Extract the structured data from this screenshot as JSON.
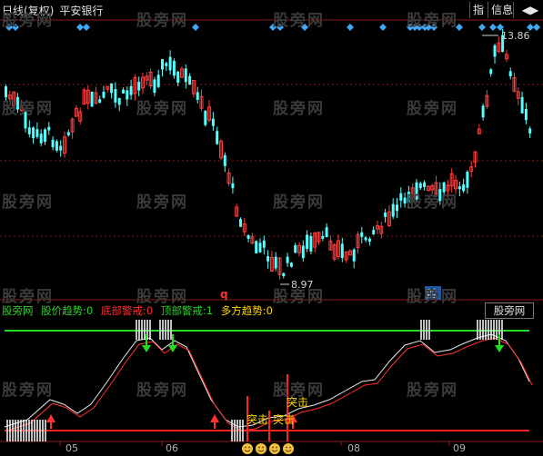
{
  "header": {
    "period": "日线(复权)",
    "stock_name": "平安银行",
    "btn_index": "指",
    "btn_info": "信息",
    "btn_nav": "◀▶"
  },
  "watermark": "股旁网",
  "main_chart": {
    "high_label": "13.86",
    "low_label": "8.97",
    "marker_q": "q",
    "marker_cai": "财"
  },
  "indicator": {
    "name": "股旁网",
    "legend": [
      {
        "label": "股价趋势:",
        "value": "0",
        "color": "#2fd02f"
      },
      {
        "label": "底部警戒:",
        "value": "0",
        "color": "#ff3030"
      },
      {
        "label": "顶部警戒:",
        "value": "1",
        "color": "#2fd02f"
      },
      {
        "label": "多方趋势:",
        "value": "0",
        "color": "#ffd700"
      }
    ],
    "label_panel": "股旁网",
    "tujī_1": "突击",
    "tujī_2": "突击",
    "tujī_3": "突击"
  },
  "axis": {
    "dates": [
      "05",
      "06",
      "08",
      "09"
    ]
  },
  "colors": {
    "up": "#ff3c3c",
    "down": "#54ffff",
    "green_line": "#22dd22",
    "red_line": "#ff2020",
    "diamond": "#3fa9f5",
    "grid": "#7a1a1a"
  }
}
